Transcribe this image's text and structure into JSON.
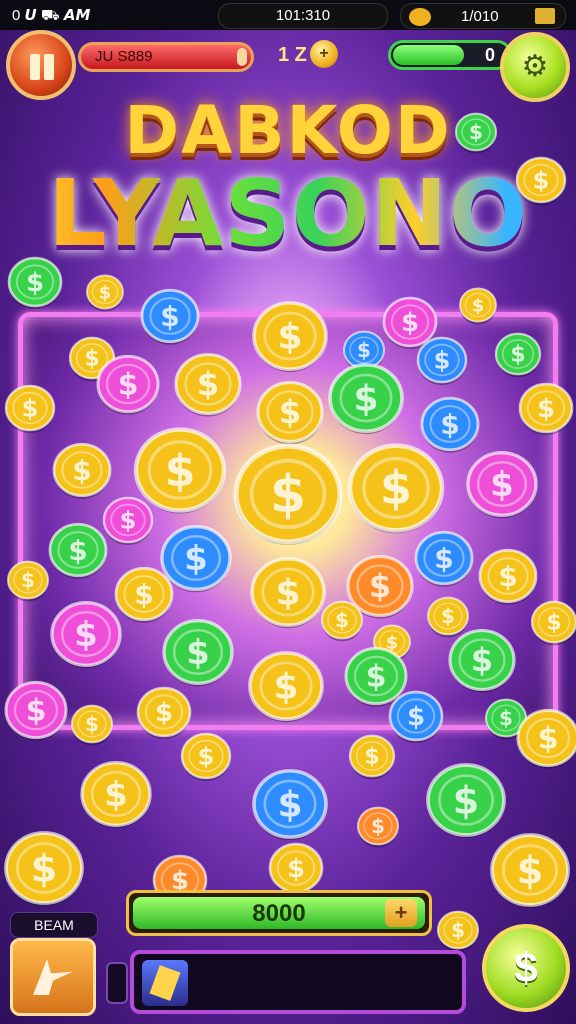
{
  "status_bar": {
    "left": "0 𝙐 ⛟ 𝘼𝙈",
    "center": "101:310",
    "right": "1/010"
  },
  "hud": {
    "red_bar_text": "JU S889",
    "mid_count": "1 Z",
    "plus_label": "+",
    "green_bar_value": "0",
    "green_bar_fill": 0.62
  },
  "title": {
    "line1": "DABKOD",
    "line2": "LYASONO"
  },
  "bottom": {
    "beam_label": "BEAM",
    "balance_value": "8000",
    "balance_plus": "+",
    "dollar_button": "$"
  },
  "colors": {
    "gold": "#f5c21a",
    "green": "#38d14a",
    "blue": "#2f8cff",
    "pink": "#ee4ed8",
    "orange": "#ff8a2a"
  },
  "icons": [
    "pause-icon",
    "gear-icon",
    "plus-icon",
    "arrow-icon",
    "dollar-icon"
  ]
}
